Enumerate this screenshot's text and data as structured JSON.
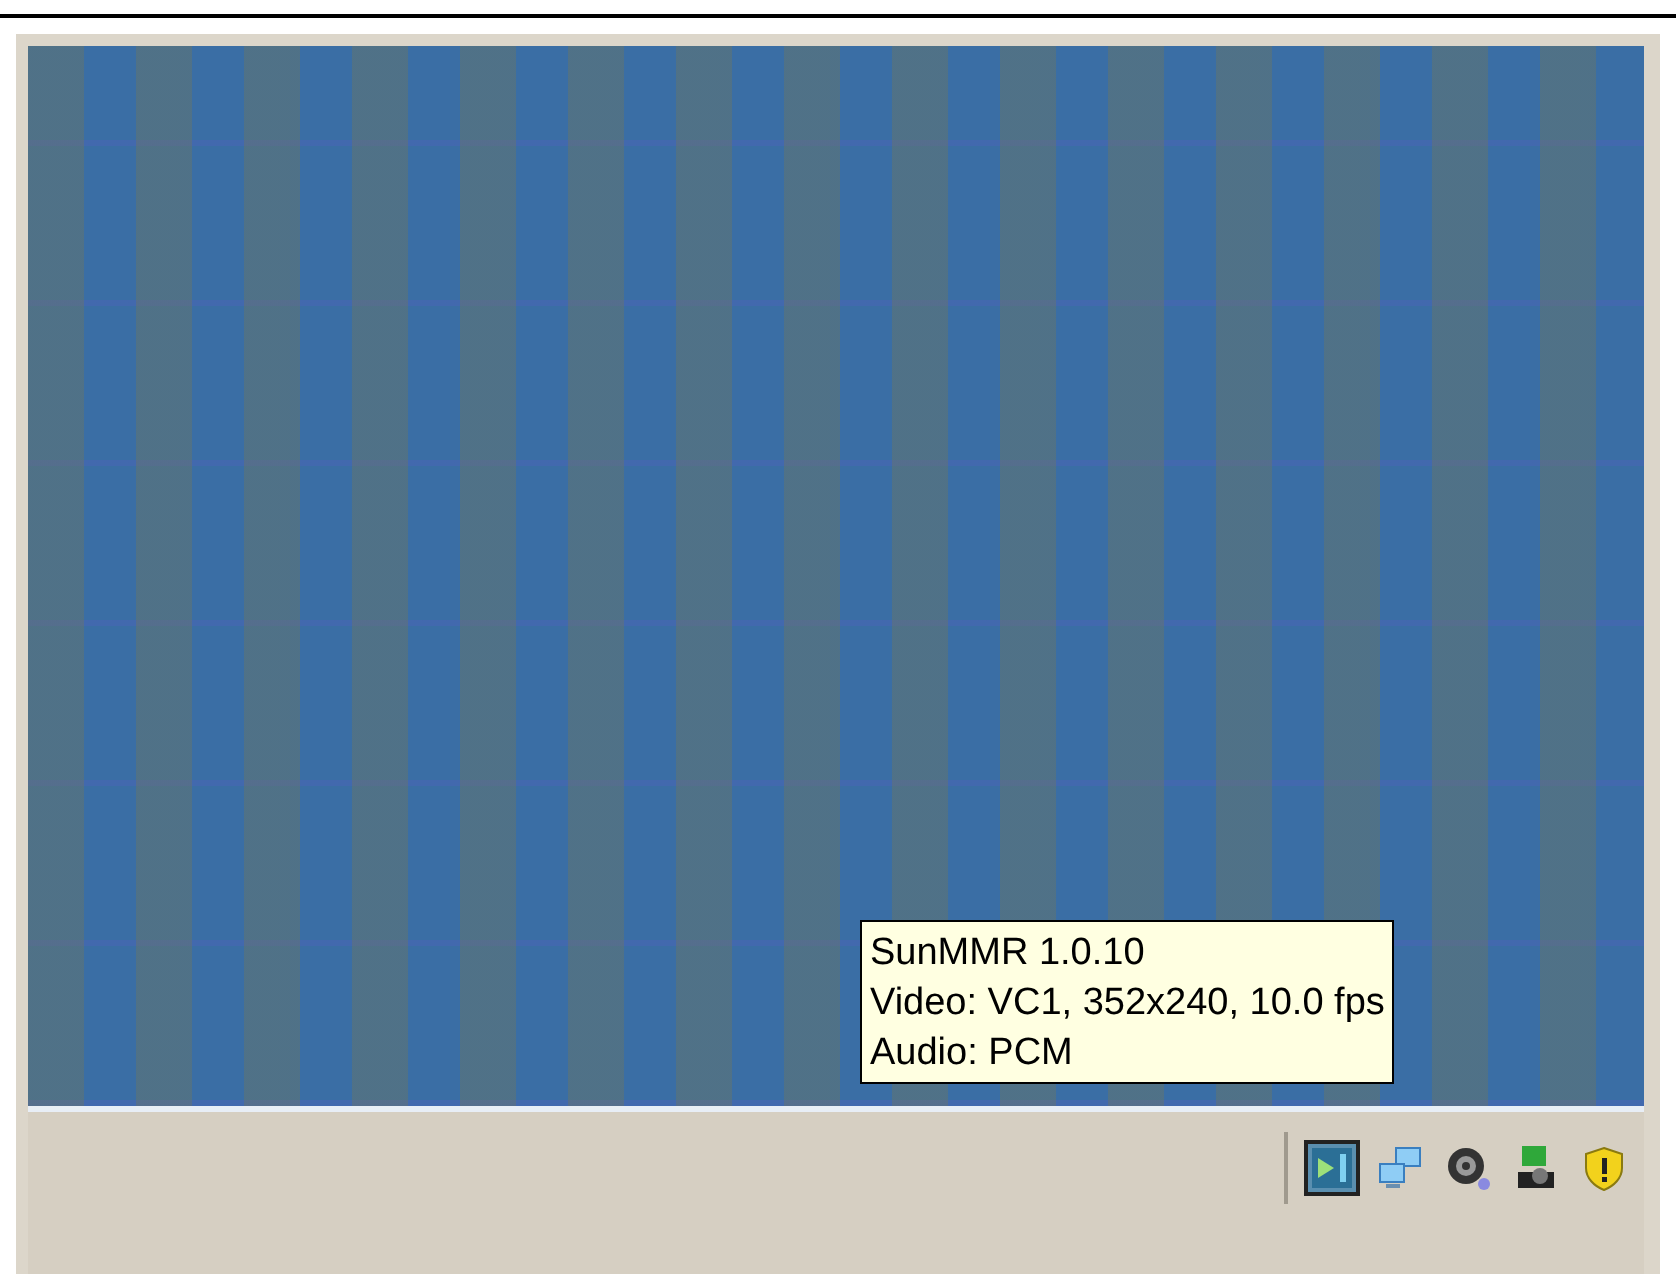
{
  "tooltip": {
    "lines": [
      "SunMMR 1.0.10",
      "Video: VC1, 352x240, 10.0 fps",
      "Audio: PCM"
    ]
  },
  "tray_icons": [
    {
      "kind": "media",
      "selected": true
    },
    {
      "kind": "network",
      "selected": false
    },
    {
      "kind": "speaker",
      "selected": false
    },
    {
      "kind": "transfer",
      "selected": false
    },
    {
      "kind": "shield",
      "selected": false
    }
  ]
}
